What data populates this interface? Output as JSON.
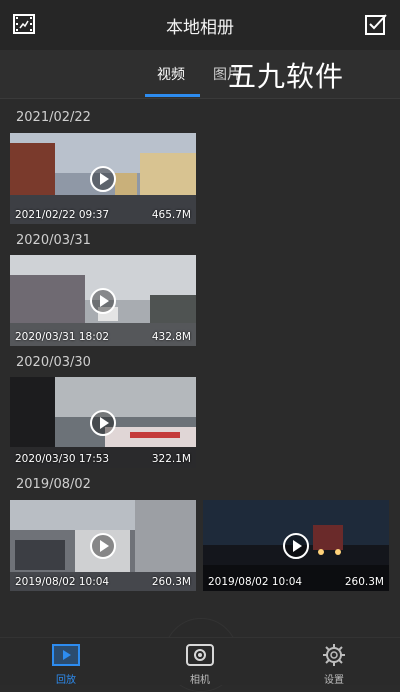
{
  "header": {
    "title": "本地相册"
  },
  "tabs": [
    {
      "label": "视频"
    },
    {
      "label": "图片"
    }
  ],
  "watermark": "五九软件",
  "groups": [
    {
      "date": "2021/02/22",
      "items": [
        {
          "stamp": "2021/02/22 09:37",
          "size": "465.7M"
        }
      ]
    },
    {
      "date": "2020/03/31",
      "items": [
        {
          "stamp": "2020/03/31 18:02",
          "size": "432.8M"
        }
      ]
    },
    {
      "date": "2020/03/30",
      "items": [
        {
          "stamp": "2020/03/30 17:53",
          "size": "322.1M"
        }
      ]
    },
    {
      "date": "2019/08/02",
      "items": [
        {
          "stamp": "2019/08/02 10:04",
          "size": "260.3M"
        },
        {
          "stamp": "2019/08/02 10:04",
          "size": "260.3M"
        }
      ]
    }
  ],
  "bottom_nav": [
    {
      "label": "回放"
    },
    {
      "label": "相机"
    },
    {
      "label": "设置"
    }
  ],
  "colors": {
    "accent": "#2d8cf0",
    "background": "#2b2b2b"
  }
}
